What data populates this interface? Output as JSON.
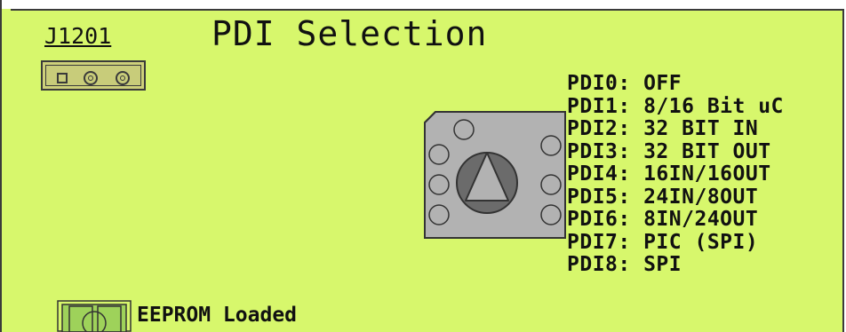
{
  "connector": {
    "label": "J1201"
  },
  "title": "PDI Selection",
  "pdi_options": [
    "PDI0: OFF",
    "PDI1: 8/16 Bit uC",
    "PDI2: 32 BIT IN",
    "PDI3: 32 BIT OUT",
    "PDI4: 16IN/16OUT",
    "PDI5: 24IN/8OUT",
    "PDI6: 8IN/24OUT",
    "PDI7: PIC (SPI)",
    "PDI8: SPI"
  ],
  "led": {
    "label": "EEPROM Loaded"
  },
  "colors": {
    "board": "#d7f76c",
    "outline": "#3a3a3a",
    "switch": "#b2b2b2",
    "knob": "#6b6b6b"
  }
}
